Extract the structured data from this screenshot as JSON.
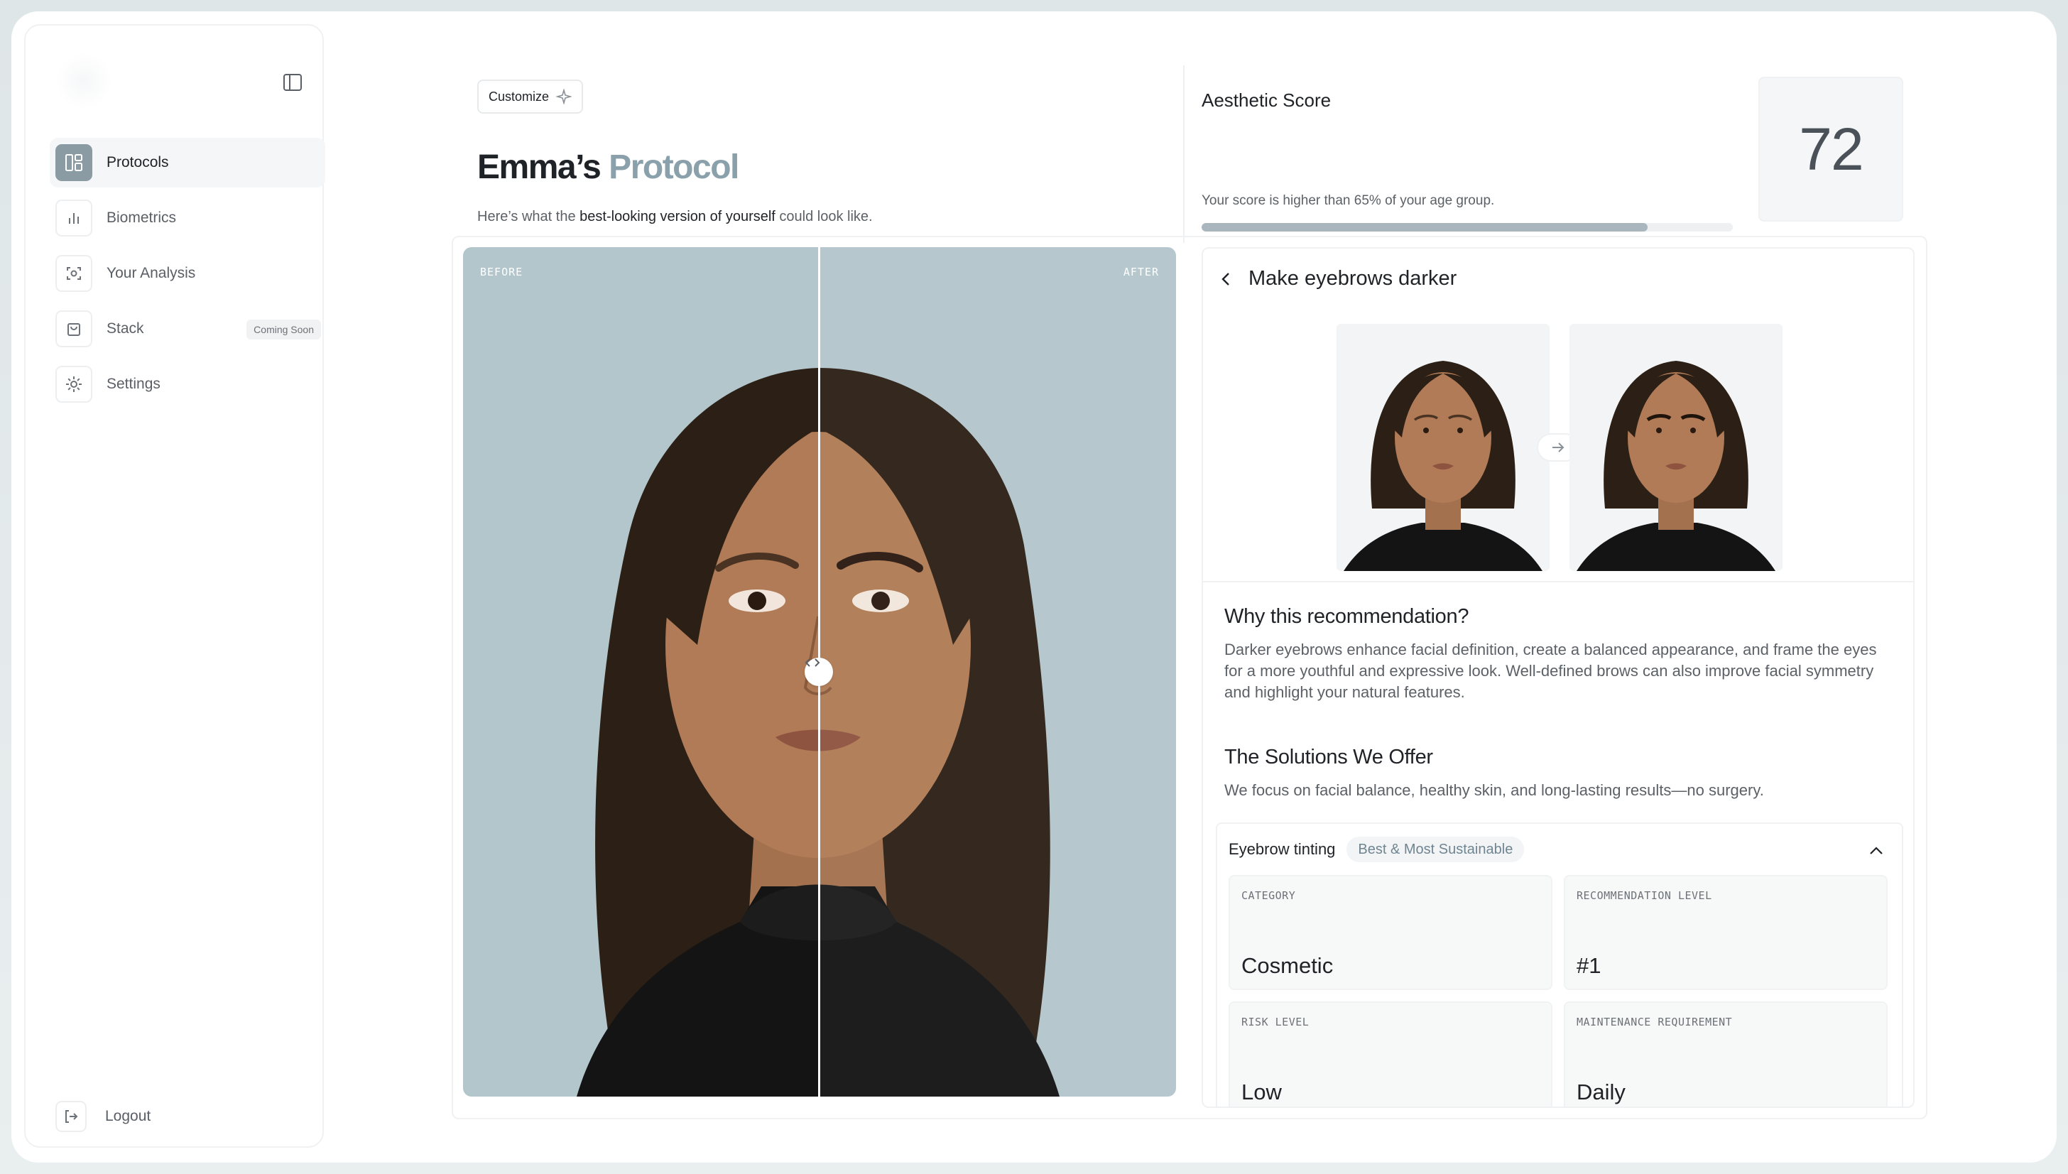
{
  "sidebar": {
    "items": [
      {
        "label": "Protocols",
        "icon": "layout-icon",
        "active": true
      },
      {
        "label": "Biometrics",
        "icon": "bar-chart-icon"
      },
      {
        "label": "Your Analysis",
        "icon": "scan-face-icon"
      },
      {
        "label": "Stack",
        "icon": "bag-icon",
        "badge": "Coming Soon"
      },
      {
        "label": "Settings",
        "icon": "gear-icon"
      }
    ],
    "logout_label": "Logout"
  },
  "header": {
    "customize_label": "Customize",
    "title_name": "Emma’s",
    "title_accent": "Protocol",
    "subtitle_pre": "Here’s what the ",
    "subtitle_bold": "best-looking version of yourself",
    "subtitle_post": " could look like."
  },
  "score": {
    "title": "Aesthetic Score",
    "text": "Your score is higher than 65% of your age group.",
    "value": "72",
    "progress_fraction": 0.84
  },
  "compare": {
    "before_label": "BEFORE",
    "after_label": "AFTER"
  },
  "recommendation": {
    "title": "Make eyebrows darker",
    "why_heading": "Why this recommendation?",
    "why_text": "Darker eyebrows enhance facial definition, create a balanced appearance, and frame the eyes for a more youthful and expressive look. Well-defined brows can also improve facial symmetry and highlight your natural features.",
    "solutions_heading": "The Solutions We Offer",
    "solutions_text": "We focus on facial balance, healthy skin, and long-lasting results—no surgery."
  },
  "solution": {
    "name": "Eyebrow tinting",
    "badge": "Best & Most Sustainable",
    "tiles": [
      {
        "label": "CATEGORY",
        "value": "Cosmetic"
      },
      {
        "label": "RECOMMENDATION LEVEL",
        "value": "#1"
      },
      {
        "label": "RISK LEVEL",
        "value": "Low"
      },
      {
        "label": "MAINTENANCE REQUIREMENT",
        "value": "Daily"
      }
    ]
  },
  "colors": {
    "accent": "#8aa1ab",
    "photo_bg": "#b3c6cc",
    "active_icon": "#8a9ba3"
  }
}
